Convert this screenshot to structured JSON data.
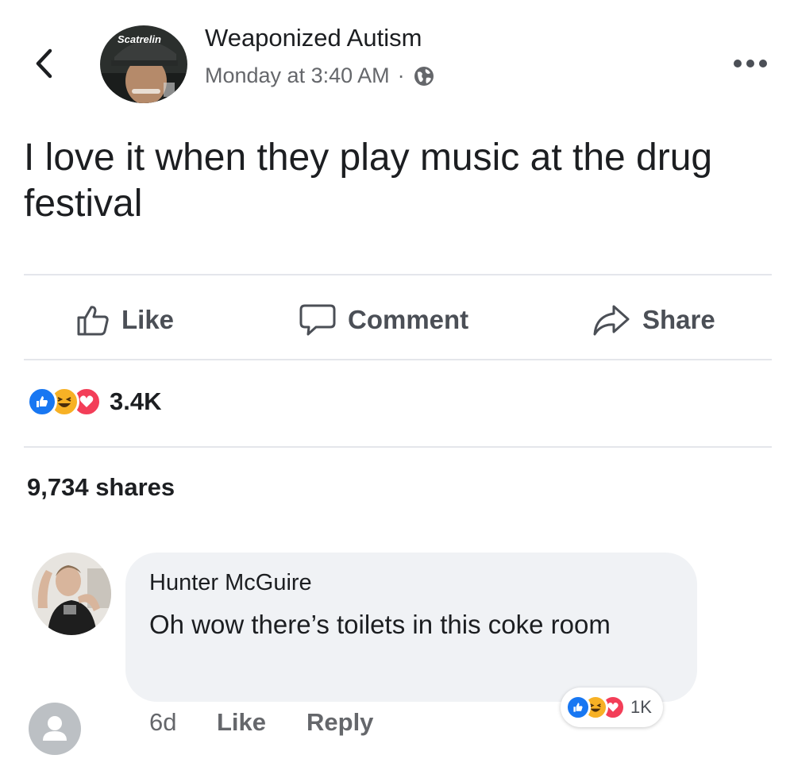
{
  "post": {
    "author": "Weaponized Autism",
    "timestamp": "Monday at 3:40 AM",
    "separator": "·",
    "privacy_icon": "globe-icon",
    "text": "I love it when they play music at the drug festival",
    "avatar_cap_text": "Scatrelin",
    "actions": {
      "like": "Like",
      "comment": "Comment",
      "share": "Share"
    },
    "reactions": {
      "types": [
        "like",
        "haha",
        "love"
      ],
      "count": "3.4K"
    },
    "shares": "9,734 shares"
  },
  "comment": {
    "author": "Hunter McGuire",
    "text": "Oh wow there’s toilets in this coke room",
    "age": "6d",
    "like_label": "Like",
    "reply_label": "Reply",
    "reactions": {
      "types": [
        "like",
        "haha",
        "love"
      ],
      "count": "1K"
    }
  },
  "colors": {
    "like": "#1877f2",
    "haha": "#f7b125",
    "love": "#f33e58",
    "bubble": "#f0f2f5",
    "muted": "#65676b"
  }
}
